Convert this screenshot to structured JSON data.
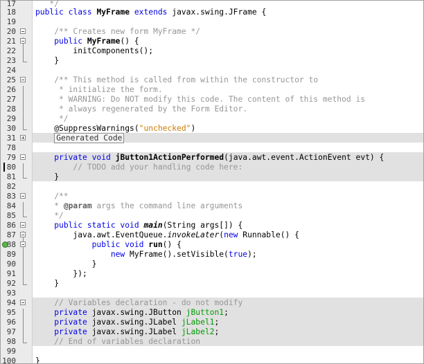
{
  "editor": {
    "lines": [
      {
        "num": "17",
        "text": "   */"
      },
      {
        "num": "18",
        "text": "public class MyFrame extends javax.swing.JFrame {"
      },
      {
        "num": "19",
        "text": ""
      },
      {
        "num": "20",
        "text": "    /** Creates new form MyFrame */"
      },
      {
        "num": "21",
        "text": "    public MyFrame() {"
      },
      {
        "num": "22",
        "text": "        initComponents();"
      },
      {
        "num": "23",
        "text": "    }"
      },
      {
        "num": "24",
        "text": ""
      },
      {
        "num": "25",
        "text": "    /** This method is called from within the constructor to"
      },
      {
        "num": "26",
        "text": "     * initialize the form."
      },
      {
        "num": "27",
        "text": "     * WARNING: Do NOT modify this code. The content of this method is"
      },
      {
        "num": "28",
        "text": "     * always regenerated by the Form Editor."
      },
      {
        "num": "29",
        "text": "     */"
      },
      {
        "num": "30",
        "text": "    @SuppressWarnings(\"unchecked\")"
      },
      {
        "num": "31",
        "text": "Generated Code"
      },
      {
        "num": "78",
        "text": ""
      },
      {
        "num": "79",
        "text": "    private void jButton1ActionPerformed(java.awt.event.ActionEvent evt) {"
      },
      {
        "num": "80",
        "text": "        // TODO add your handling code here:"
      },
      {
        "num": "81",
        "text": "    }"
      },
      {
        "num": "82",
        "text": ""
      },
      {
        "num": "83",
        "text": "    /**"
      },
      {
        "num": "84",
        "text": "    * @param args the command line arguments"
      },
      {
        "num": "85",
        "text": "    */"
      },
      {
        "num": "86",
        "text": "    public static void main(String args[]) {"
      },
      {
        "num": "87",
        "text": "        java.awt.EventQueue.invokeLater(new Runnable() {"
      },
      {
        "num": "88",
        "text": "            public void run() {"
      },
      {
        "num": "89",
        "text": "                new MyFrame().setVisible(true);"
      },
      {
        "num": "90",
        "text": "            }"
      },
      {
        "num": "91",
        "text": "        });"
      },
      {
        "num": "92",
        "text": "    }"
      },
      {
        "num": "93",
        "text": ""
      },
      {
        "num": "94",
        "text": "    // Variables declaration - do not modify"
      },
      {
        "num": "95",
        "text": "    private javax.swing.JButton jButton1;"
      },
      {
        "num": "96",
        "text": "    private javax.swing.JLabel jLabel1;"
      },
      {
        "num": "97",
        "text": "    private javax.swing.JLabel jLabel2;"
      },
      {
        "num": "98",
        "text": "    // End of variables declaration"
      },
      {
        "num": "99",
        "text": ""
      },
      {
        "num": "100",
        "text": "}"
      }
    ],
    "colors": {
      "keyword": "#0000e6",
      "comment": "#969696",
      "string": "#ce7b00",
      "field": "#009900",
      "guarded_block": "#e1e1e1",
      "gutter": "#ebebeb"
    },
    "icons": {
      "fold_collapse": "minus-box",
      "fold_expand": "plus-box",
      "breakpoint": "green-circle"
    }
  }
}
